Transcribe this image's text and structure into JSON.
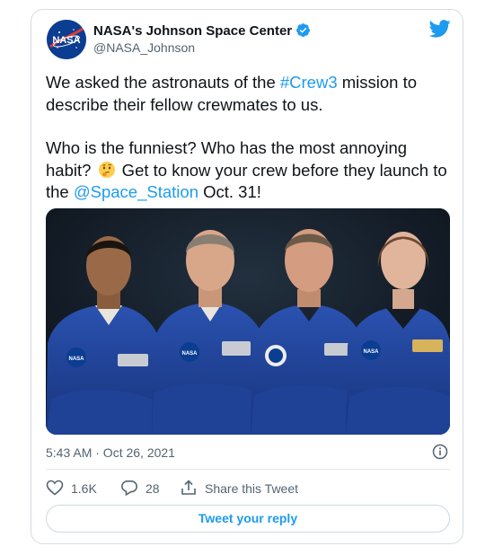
{
  "author": {
    "name": "NASA's Johnson Space Center",
    "handle": "@NASA_Johnson",
    "avatar_text": "NASA"
  },
  "tweet": {
    "line1_pre": "We asked the astronauts of the ",
    "hashtag": "#Crew3",
    "line1_post": " mission to describe their fellow crewmates to us.",
    "line2_pre": "Who is the funniest? Who has the most annoying habit?",
    "line2_mid": " Get to know your crew before they launch to the ",
    "mention": "@Space_Station",
    "line2_post": " Oct. 31!"
  },
  "meta": {
    "timestamp": "5:43 AM · Oct 26, 2021"
  },
  "actions": {
    "likes": "1.6K",
    "replies": "28",
    "share": "Share this Tweet"
  },
  "reply_button": "Tweet your reply",
  "media_patch_text": "NASA",
  "colors": {
    "link": "#1d9bf0",
    "suit": "#1c3f8f",
    "background": "#121a24"
  },
  "icons": [
    "nasa-avatar",
    "verified-badge-icon",
    "twitter-bird-icon",
    "thinking-face-emoji",
    "info-icon",
    "heart-icon",
    "reply-bubble-icon",
    "share-icon"
  ]
}
